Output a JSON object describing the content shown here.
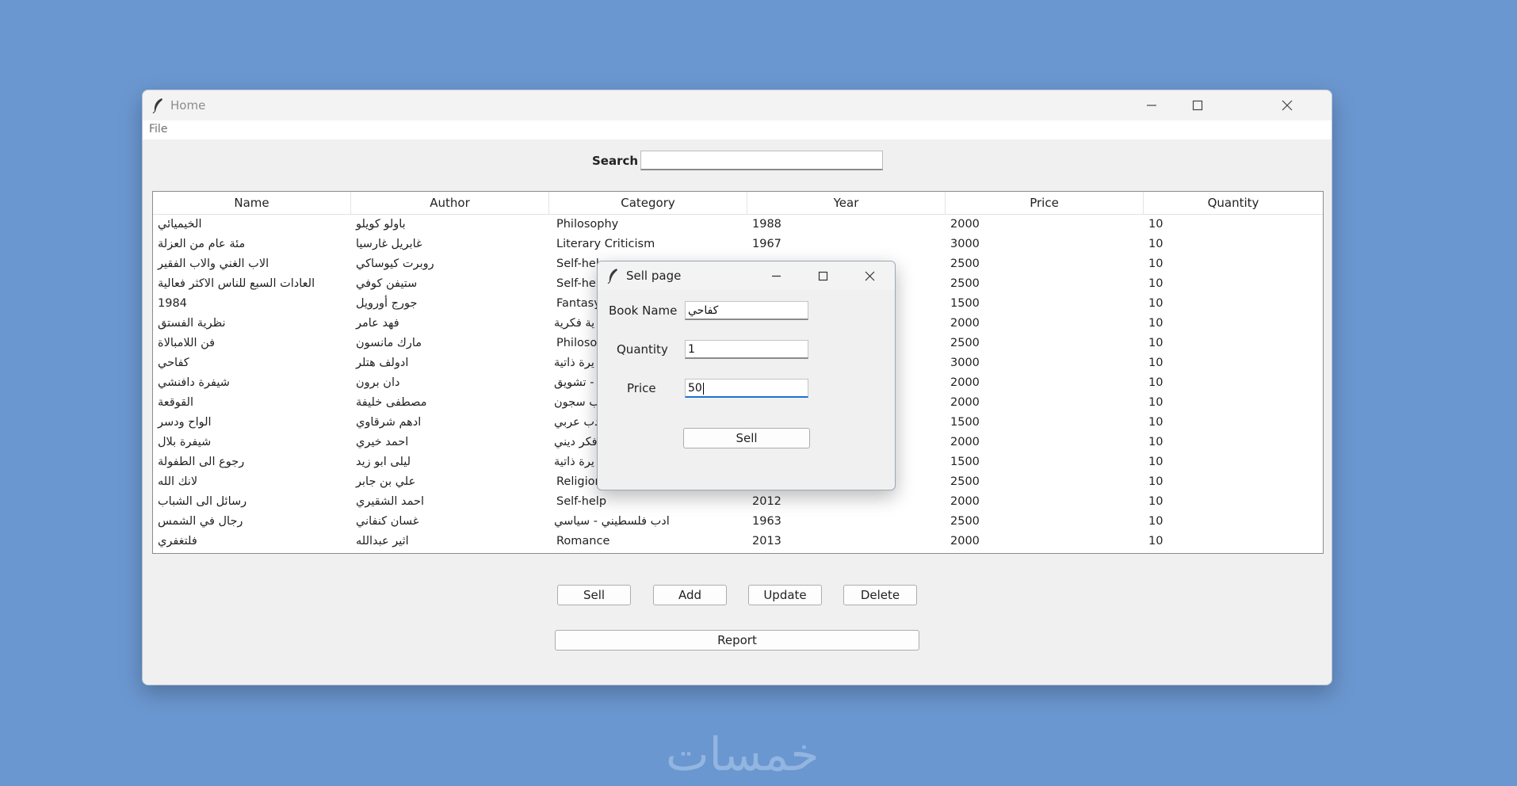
{
  "window": {
    "title": "Home"
  },
  "menu": {
    "file": "File"
  },
  "search": {
    "label": "Search",
    "value": ""
  },
  "table": {
    "headers": [
      "Name",
      "Author",
      "Category",
      "Year",
      "Price",
      "Quantity"
    ],
    "rows": [
      [
        "الخيميائي",
        "باولو كويلو",
        "Philosophy",
        "1988",
        "2000",
        "10"
      ],
      [
        "مئة عام من العزلة",
        "غابريل غارسيا",
        "Literary Criticism",
        "1967",
        "3000",
        "10"
      ],
      [
        "الاب الغني والاب الفقير",
        "روبرت كيوساكي",
        "Self-hel",
        "",
        "2500",
        "10"
      ],
      [
        "العادات السبع للناس الاكثر فعالية",
        "ستيفن كوفي",
        "Self-hel",
        "",
        "2500",
        "10"
      ],
      [
        "1984",
        "جورج أورويل",
        "Fantasy",
        "",
        "1500",
        "10"
      ],
      [
        "نظرية الفستق",
        "فهد عامر",
        "ية فكرية",
        "",
        "2000",
        "10"
      ],
      [
        "فن اللامبالاة",
        "مارك مانسون",
        "Philoso",
        "",
        "2500",
        "10"
      ],
      [
        "كفاحي",
        "ادولف هتلر",
        "يرة ذاتية",
        "",
        "3000",
        "10"
      ],
      [
        "شيفرة دافنشي",
        "دان برون",
        "- تشويق",
        "",
        "2000",
        "10"
      ],
      [
        "القوقعة",
        "مصطفى خليفة",
        "ب سجون",
        "",
        "2000",
        "10"
      ],
      [
        "الواح ودسر",
        "ادهم شرقاوي",
        "دب عربي",
        "",
        "1500",
        "10"
      ],
      [
        "شيفرة بلال",
        "احمد خيري",
        "فكر ديني",
        "",
        "2000",
        "10"
      ],
      [
        "رجوع الى الطفولة",
        "ليلى ابو زيد",
        "يرة ذاتية",
        "",
        "1500",
        "10"
      ],
      [
        "لانك الله",
        "علي بن جابر",
        "Religion",
        "",
        "2500",
        "10"
      ],
      [
        "رسائل الى الشباب",
        "احمد الشقيري",
        "Self-help",
        "2012",
        "2000",
        "10"
      ],
      [
        "رجال في الشمس",
        "غسان كنفاني",
        "ادب فلسطيني - سياسي",
        "1963",
        "2500",
        "10"
      ],
      [
        "فلتغفري",
        "اثير عبدالله",
        "Romance",
        "2013",
        "2000",
        "10"
      ]
    ]
  },
  "buttons": {
    "sell": "Sell",
    "add": "Add",
    "update": "Update",
    "delete": "Delete",
    "report": "Report"
  },
  "dialog": {
    "title": "Sell page",
    "book_name_label": "Book Name",
    "book_name_value": "كفاحي",
    "quantity_label": "Quantity",
    "quantity_value": "1",
    "price_label": "Price",
    "price_value": "50",
    "sell_button": "Sell"
  },
  "watermark": "خمسات",
  "colors": {
    "desktop": "#6b97d0",
    "window": "#f0f0f0",
    "focus": "#1f6fd6"
  }
}
